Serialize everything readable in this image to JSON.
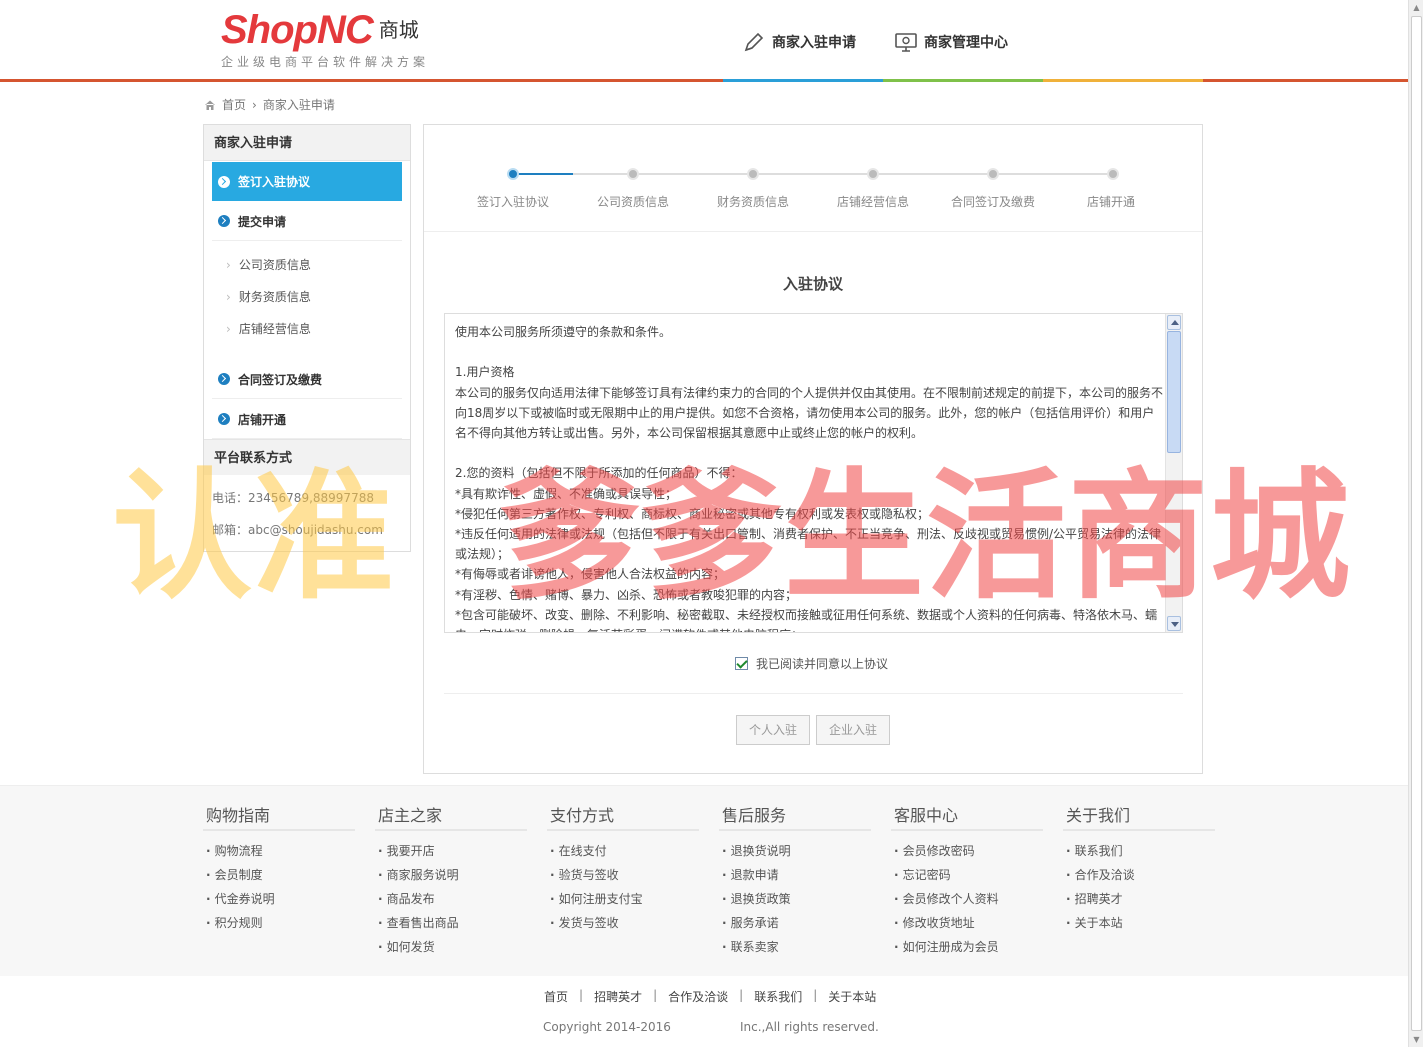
{
  "header": {
    "logo_main": "ShopNC",
    "logo_cn": "商城",
    "logo_sub": "企业级电商平台软件解决方案",
    "nav": [
      {
        "label": "商家入驻申请",
        "icon": "pen-icon"
      },
      {
        "label": "商家管理中心",
        "icon": "monitor-icon"
      }
    ]
  },
  "breadcrumb": {
    "home": "首页",
    "current": "商家入驻申请"
  },
  "sidebar": {
    "title": "商家入驻申请",
    "steps": [
      {
        "label": "签订入驻协议",
        "active": true
      },
      {
        "label": "提交申请",
        "active": false
      },
      {
        "label": "合同签订及缴费",
        "active": false
      },
      {
        "label": "店铺开通",
        "active": false
      }
    ],
    "sub_items": [
      "公司资质信息",
      "财务资质信息",
      "店铺经营信息"
    ],
    "contact_title": "平台联系方式",
    "phone": "电话：23456789,88997788",
    "email": "邮箱：abc@shoujidashu.com"
  },
  "progress": {
    "steps": [
      "签订入驻协议",
      "公司资质信息",
      "财务资质信息",
      "店铺经营信息",
      "合同签订及缴费",
      "店铺开通"
    ],
    "current": 1
  },
  "agreement": {
    "title": "入驻协议",
    "text": "使用本公司服务所须遵守的条款和条件。\n\n1.用户资格\n本公司的服务仅向适用法律下能够签订具有法律约束力的合同的个人提供并仅由其使用。在不限制前述规定的前提下，本公司的服务不向18周岁以下或被临时或无限期中止的用户提供。如您不合资格，请勿使用本公司的服务。此外，您的帐户（包括信用评价）和用户名不得向其他方转让或出售。另外，本公司保留根据其意愿中止或终止您的帐户的权利。\n\n2.您的资料（包括但不限于所添加的任何商品）不得：\n*具有欺诈性、虚假、不准确或具误导性；\n*侵犯任何第三方著作权、专利权、商标权、商业秘密或其他专有权利或发表权或隐私权；\n*违反任何适用的法律或法规（包括但不限于有关出口管制、消费者保护、不正当竞争、刑法、反歧视或贸易惯例/公平贸易法律的法律或法规）；\n*有侮辱或者诽谤他人，侵害他人合法权益的内容；\n*有淫秽、色情、赌博、暴力、凶杀、恐怖或者教唆犯罪的内容；\n*包含可能破坏、改变、删除、不利影响、秘密截取、未经授权而接触或征用任何系统、数据或个人资料的任何病毒、特洛依木马、蠕虫、定时炸弹、删除蝇、复活节彩蛋、间谍软件或其他电脑程序；",
    "checkbox_label": "我已阅读并同意以上协议",
    "checked": true,
    "buttons": [
      "个人入驻",
      "企业入驻"
    ]
  },
  "footer": {
    "columns": [
      {
        "title": "购物指南",
        "items": [
          "购物流程",
          "会员制度",
          "代金券说明",
          "积分规则"
        ]
      },
      {
        "title": "店主之家",
        "items": [
          "我要开店",
          "商家服务说明",
          "商品发布",
          "查看售出商品",
          "如何发货"
        ]
      },
      {
        "title": "支付方式",
        "items": [
          "在线支付",
          "验货与签收",
          "如何注册支付宝",
          "发货与签收"
        ]
      },
      {
        "title": "售后服务",
        "items": [
          "退换货说明",
          "退款申请",
          "退换货政策",
          "服务承诺",
          "联系卖家"
        ]
      },
      {
        "title": "客服中心",
        "items": [
          "会员修改密码",
          "忘记密码",
          "会员修改个人资料",
          "修改收货地址",
          "如何注册成为会员"
        ]
      },
      {
        "title": "关于我们",
        "items": [
          "联系我们",
          "合作及洽谈",
          "招聘英才",
          "关于本站"
        ]
      }
    ],
    "bottom_links": [
      "首页",
      "招聘英才",
      "合作及洽谈",
      "联系我们",
      "关于本站"
    ],
    "copyright": "Copyright 2014-2016",
    "rights": "Inc.,All rights reserved."
  },
  "watermark": {
    "part1": "认准",
    "part2": "爹爹生活商城"
  },
  "colors": {
    "accent": "#28a9e1",
    "step_blue": "#1e7fc0",
    "brand_red": "#e4393c"
  }
}
